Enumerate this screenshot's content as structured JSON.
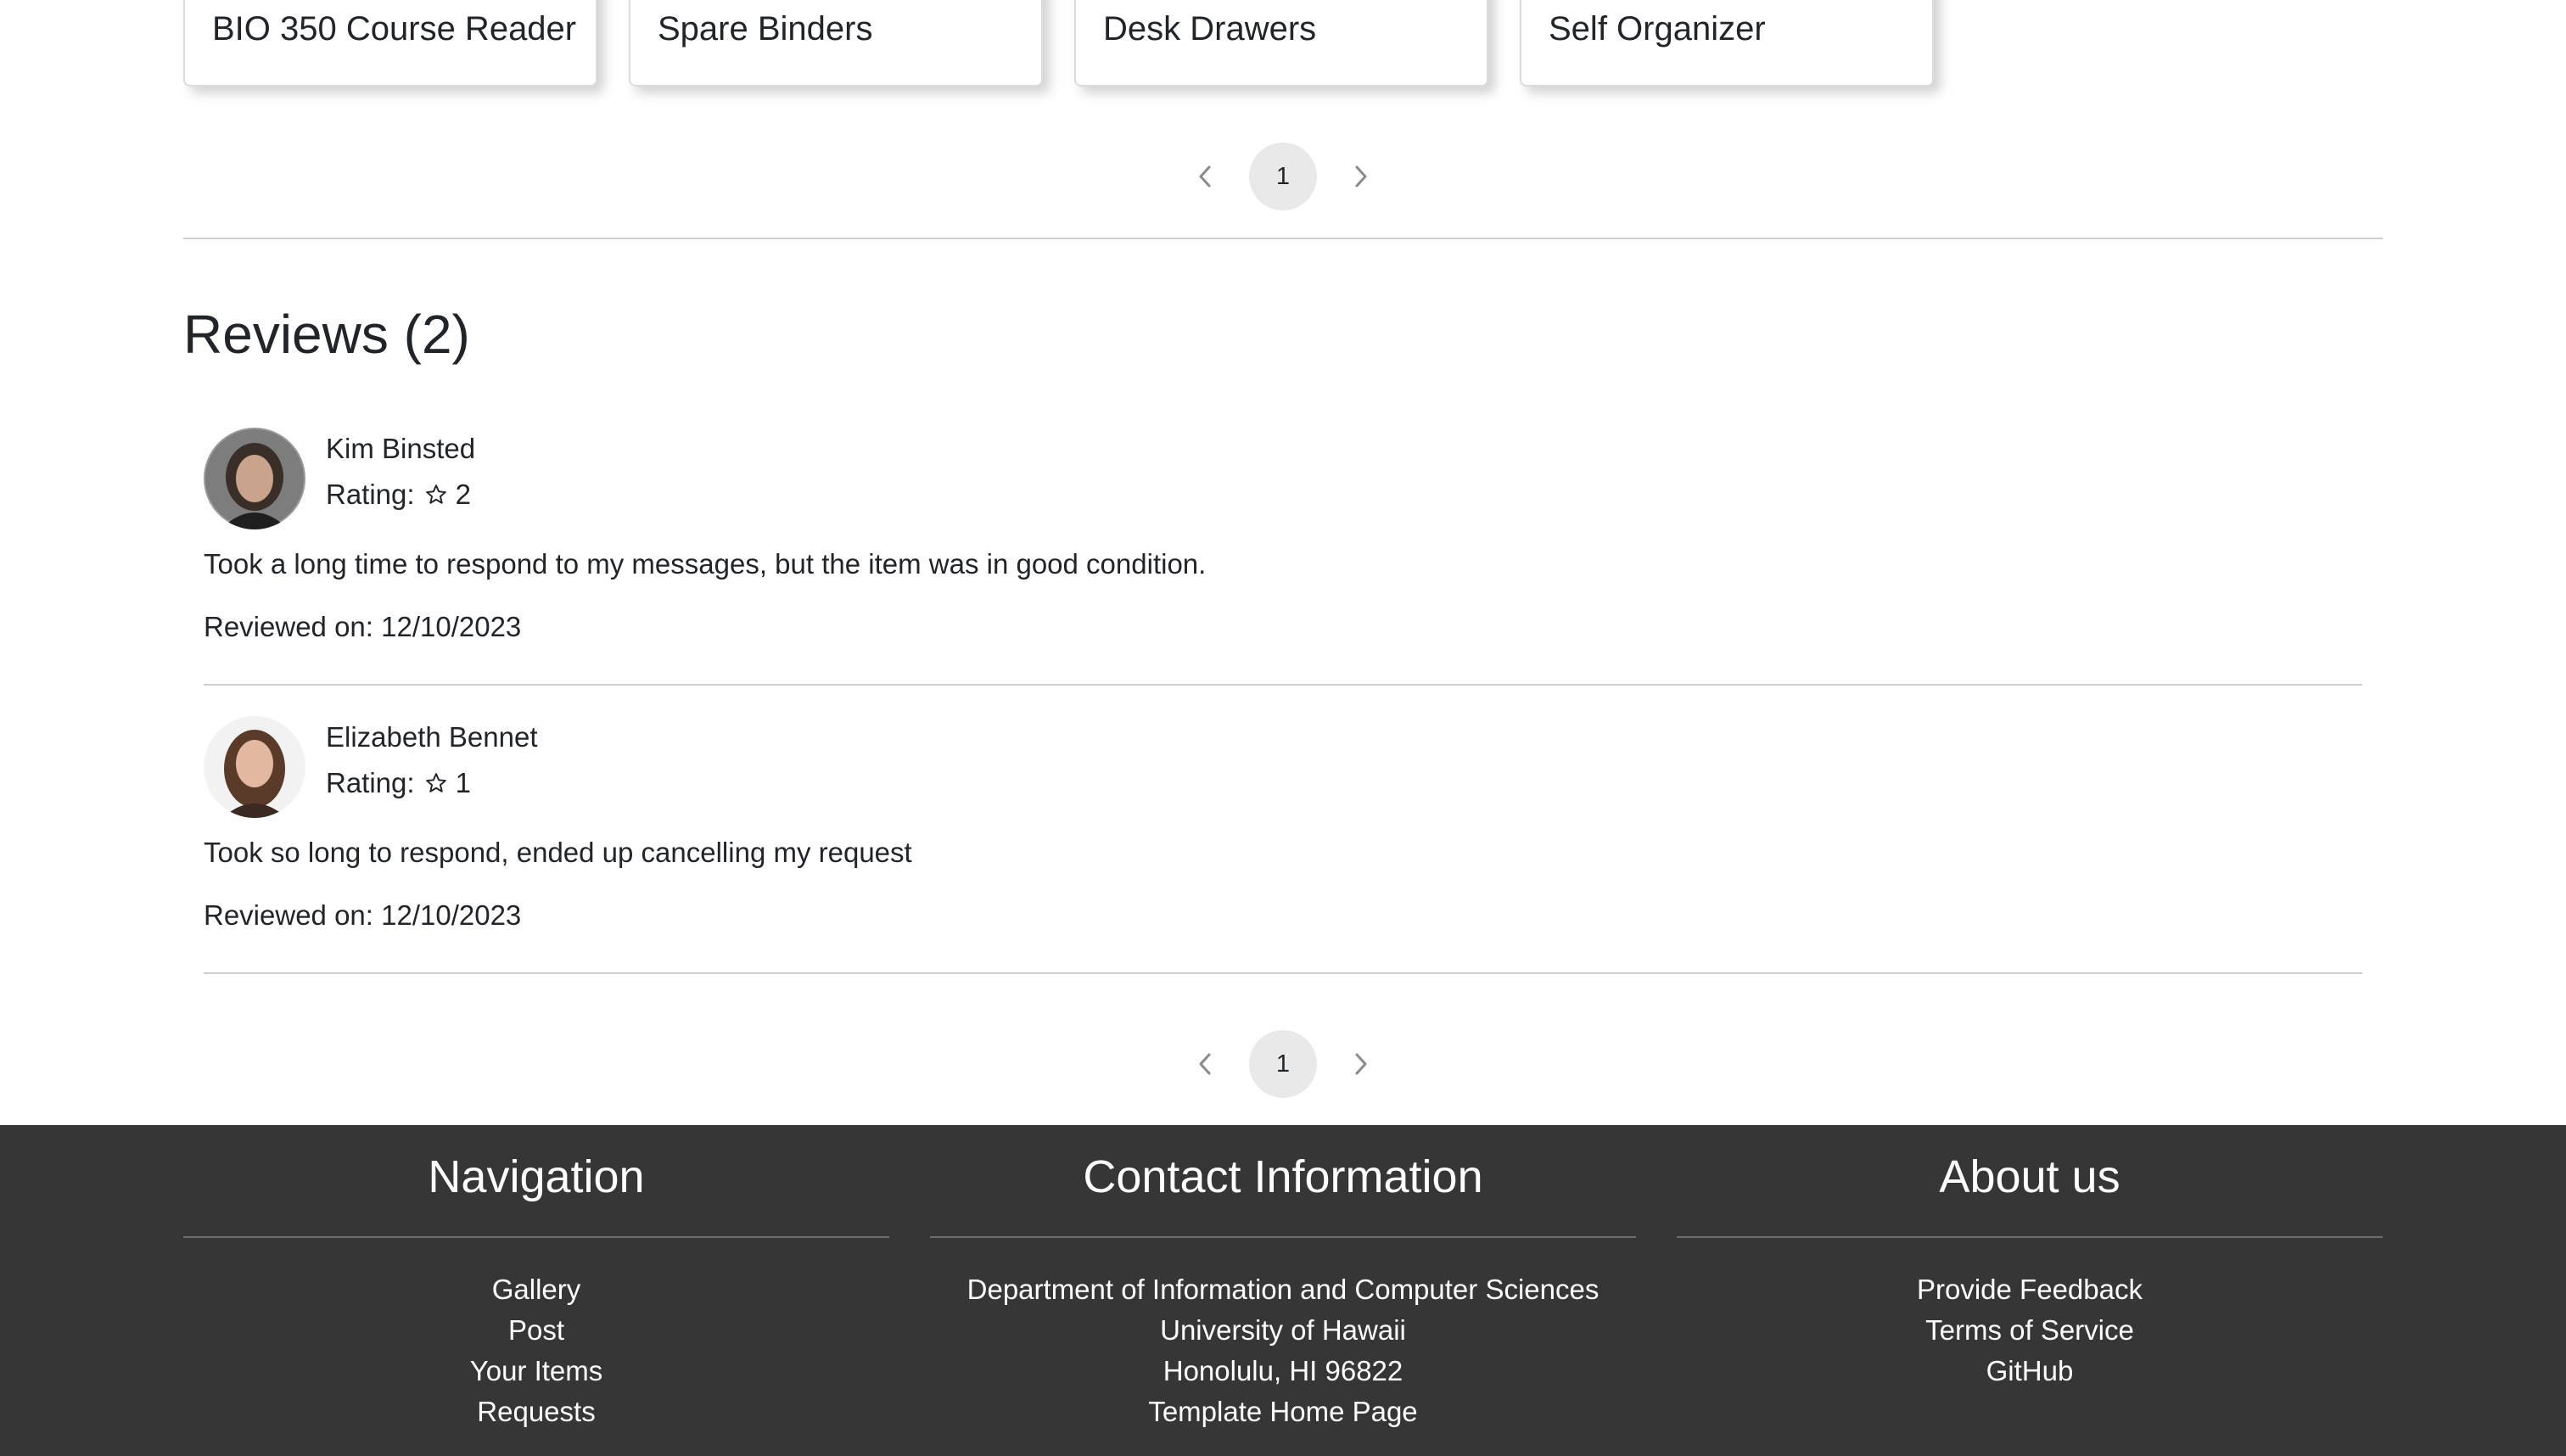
{
  "items": {
    "cards": [
      {
        "title": "BIO 350 Course Reader"
      },
      {
        "title": "Spare Binders"
      },
      {
        "title": "Desk Drawers"
      },
      {
        "title": "Self Organizer"
      }
    ],
    "pagination": {
      "current_page": "1",
      "prev_icon": "chevron-left-icon",
      "next_icon": "chevron-right-icon"
    }
  },
  "reviews": {
    "heading": "Reviews (2)",
    "list": [
      {
        "reviewer": "Kim Binsted",
        "rating_label": "Rating:",
        "rating_value": "2",
        "comment": "Took a long time to respond to my messages, but the item was in good condition.",
        "reviewed_on": "Reviewed on: 12/10/2023"
      },
      {
        "reviewer": "Elizabeth Bennet",
        "rating_label": "Rating:",
        "rating_value": "1",
        "comment": "Took so long to respond, ended up cancelling my request",
        "reviewed_on": "Reviewed on: 12/10/2023"
      }
    ],
    "pagination": {
      "current_page": "1"
    }
  },
  "footer": {
    "background": "#363636",
    "navigation": {
      "heading": "Navigation",
      "links": [
        "Gallery",
        "Post",
        "Your Items",
        "Requests"
      ]
    },
    "contact": {
      "heading": "Contact Information",
      "lines": [
        "Department of Information and Computer Sciences",
        "University of Hawaii",
        "Honolulu, HI 96822"
      ],
      "link": "Template Home Page"
    },
    "about": {
      "heading": "About us",
      "links": [
        "Provide Feedback",
        "Terms of Service",
        "GitHub"
      ]
    }
  }
}
